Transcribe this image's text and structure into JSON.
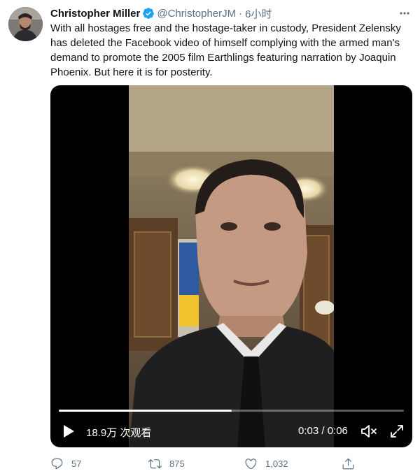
{
  "tweet": {
    "author_name": "Christopher Miller",
    "handle": "@ChristopherJM",
    "separator": "·",
    "time": "6小时",
    "text": "With all hostages free and the hostage-taker in custody, President Zelensky has deleted the Facebook video of himself complying with the armed man's demand to promote the 2005 film Earthlings featuring narration by Joaquin Phoenix. But here it is for posterity."
  },
  "video": {
    "views": "18.9万 次观看",
    "timecode": "0:03 / 0:06",
    "progress": 0.5
  },
  "actions": {
    "replies": "57",
    "retweets": "875",
    "likes": "1,032"
  },
  "colors": {
    "verified": "#1da1f2",
    "secondary_text": "#5b7083",
    "flag_blue": "#2d5aa0",
    "flag_yellow": "#f2c12e"
  },
  "icons": [
    "verified-badge-icon",
    "more-icon",
    "play-icon",
    "volume-muted-icon",
    "fullscreen-icon",
    "reply-icon",
    "retweet-icon",
    "like-icon",
    "share-icon"
  ]
}
